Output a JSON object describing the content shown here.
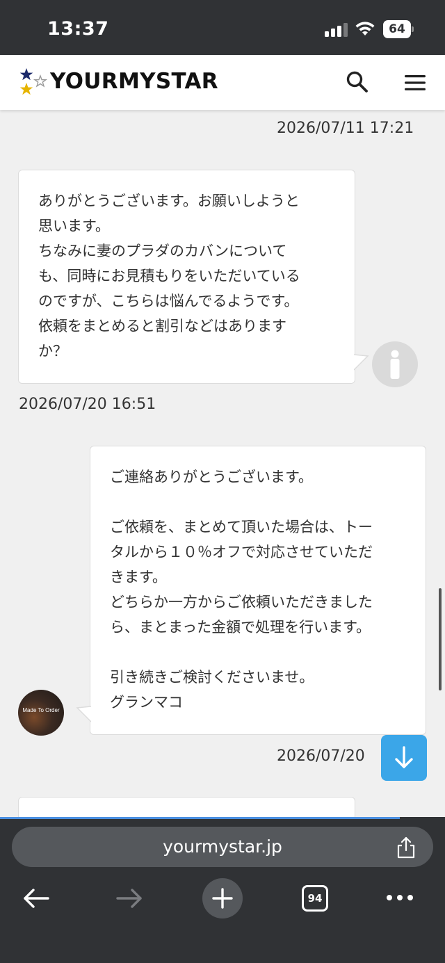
{
  "status_bar": {
    "time": "13:37",
    "battery": "64"
  },
  "header": {
    "logo_text": "YOURMYSTAR"
  },
  "messages": [
    {
      "timestamp": "2026/07/11 17:21"
    },
    {
      "sender": "user",
      "text": "ありがとうございます。お願いしようと\n思います。\nちなみに妻のプラダのカバンについて\nも、同時にお見積もりをいただいている\nのですが、こちらは悩んでるようです。\n依頼をまとめると割引などはあります\nか？",
      "timestamp": "2026/07/20 16:51"
    },
    {
      "sender": "shop",
      "avatar_label": "Made To Order",
      "text": "ご連絡ありがとうございます。\n\nご依頼を、まとめて頂いた場合は、トー\nタルから１０％オフで対応させていただ\nきます。\nどちらか一方からご依頼いただきました\nら、まとまった金額で処理を行います。\n\n引き続きご検討くださいませ。\nグランマコ",
      "timestamp": "2026/07/20"
    }
  ],
  "browser": {
    "url": "yourmystar.jp",
    "tab_count": "94"
  },
  "colors": {
    "accent_blue": "#3ba6e8",
    "star_navy": "#1c2a6b",
    "star_gold": "#e6b400"
  }
}
